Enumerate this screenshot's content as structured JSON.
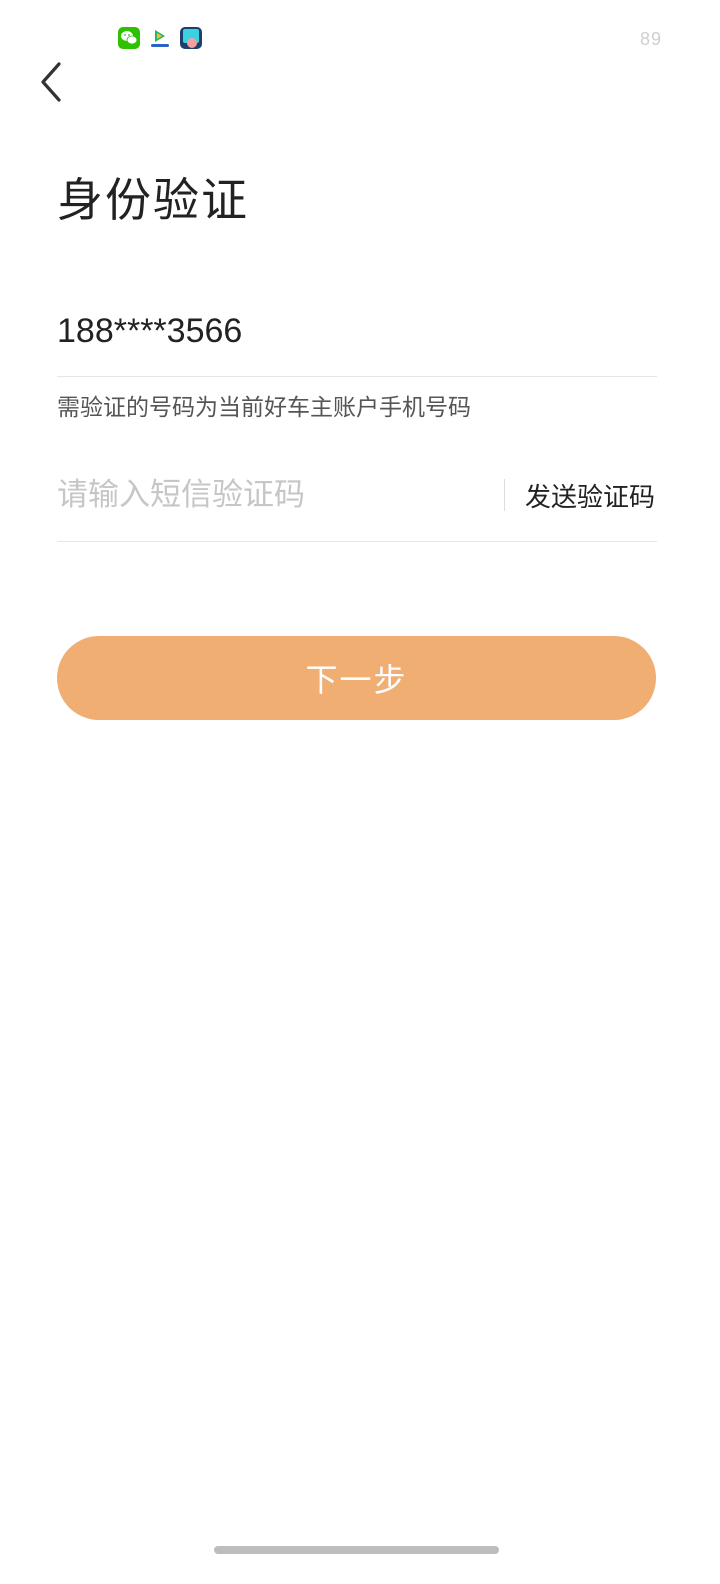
{
  "status_bar": {
    "battery": "89",
    "icons": [
      "wechat-icon",
      "video-app-icon",
      "assist-app-icon"
    ]
  },
  "header": {
    "back_icon": "chevron-left-icon"
  },
  "page": {
    "title": "身份验证"
  },
  "phone": {
    "value": "188****3566",
    "hint": "需验证的号码为当前好车主账户手机号码"
  },
  "sms": {
    "placeholder": "请输入短信验证码",
    "value": "",
    "send_label": "发送验证码"
  },
  "actions": {
    "next_label": "下一步"
  },
  "colors": {
    "accent": "#f0ae72",
    "text": "#222222",
    "placeholder": "#c6c6c6",
    "divider": "#e6e6e6"
  }
}
